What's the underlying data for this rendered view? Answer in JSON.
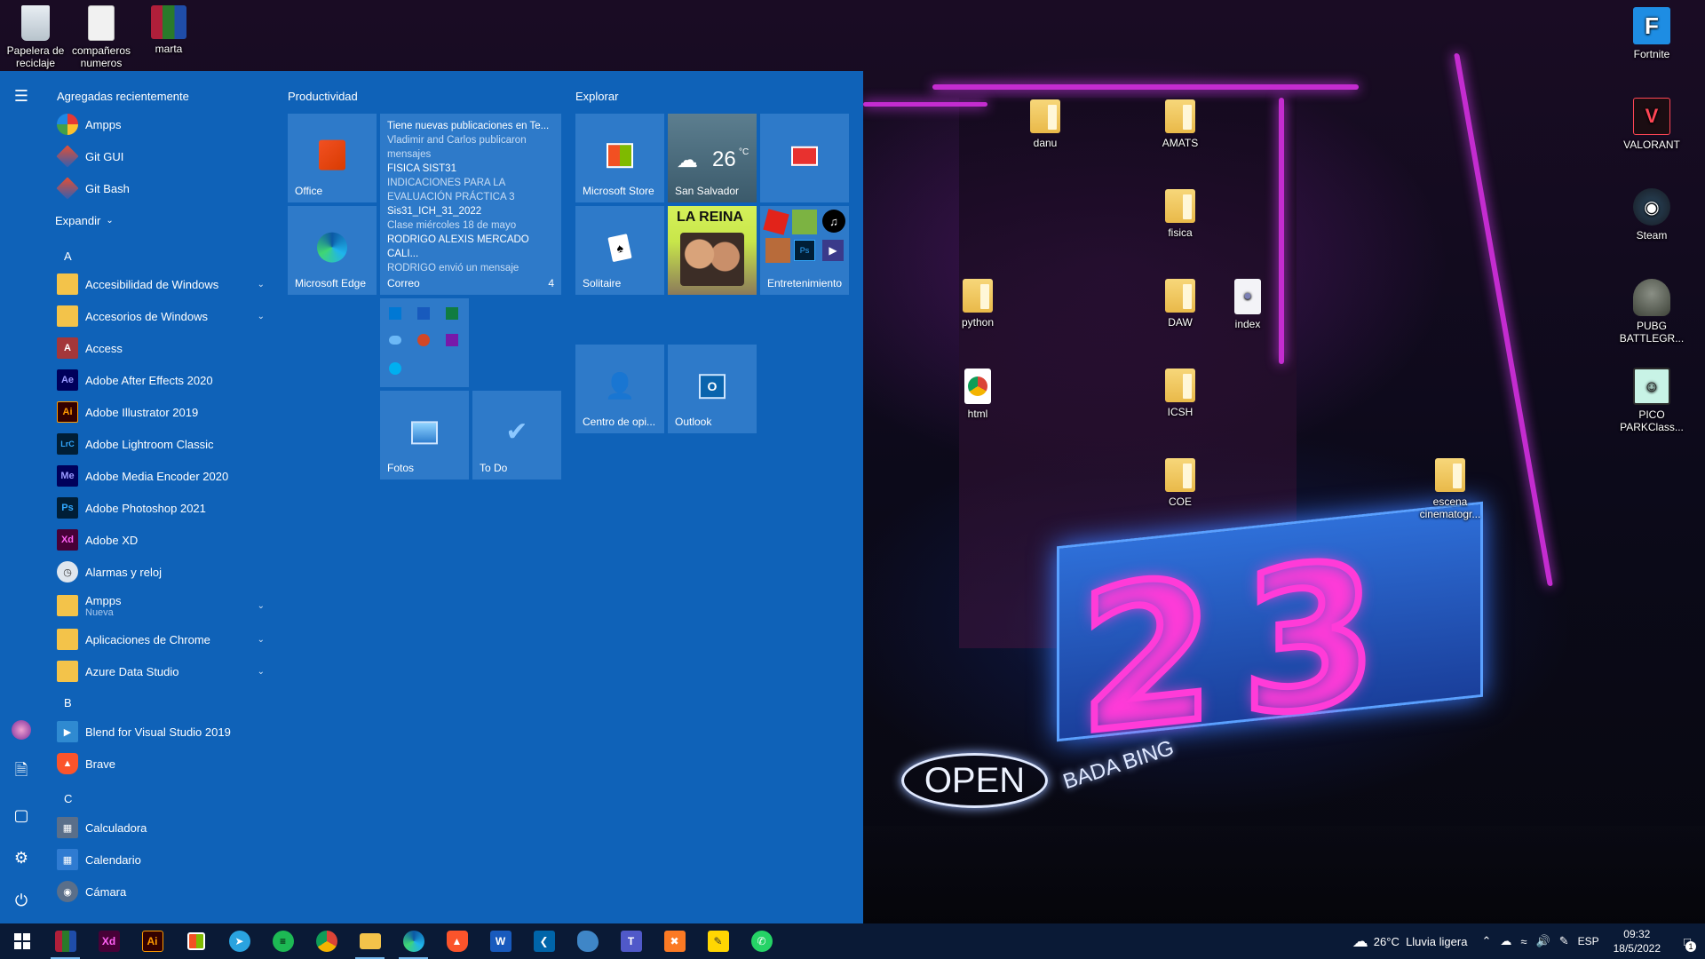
{
  "desktop": {
    "top_icons": [
      {
        "label": "Papelera de reciclaje"
      },
      {
        "label": "compañeros numeros"
      },
      {
        "label": "marta"
      }
    ],
    "folders": [
      {
        "label": "danu"
      },
      {
        "label": "AMATS"
      },
      {
        "label": "fisica"
      },
      {
        "label": "python"
      },
      {
        "label": "DAW"
      },
      {
        "label": "index"
      },
      {
        "label": "html"
      },
      {
        "label": "ICSH"
      },
      {
        "label": "COE"
      },
      {
        "label": "escena cinematogr..."
      }
    ],
    "right_icons": [
      {
        "label": "Fortnite"
      },
      {
        "label": "VALORANT"
      },
      {
        "label": "Steam"
      },
      {
        "label": "PUBG BATTLEGR..."
      },
      {
        "label": "PICO PARKClass..."
      }
    ],
    "wallpaper": {
      "sign_number": "23",
      "neon_open": "OPEN",
      "neon_bada": "BADA BING"
    }
  },
  "start_menu": {
    "recent_header": "Agregadas recientemente",
    "recent": [
      {
        "label": "Ampps"
      },
      {
        "label": "Git GUI"
      },
      {
        "label": "Git Bash"
      }
    ],
    "expand_label": "Expandir",
    "letters": {
      "a": "A",
      "b": "B",
      "c": "C"
    },
    "apps_a": [
      {
        "label": "Accesibilidad de Windows",
        "icon": "A"
      },
      {
        "label": "Accesorios de Windows",
        "icon": ""
      },
      {
        "label": "Access",
        "icon": "A"
      },
      {
        "label": "Adobe After Effects 2020",
        "icon": "Ae"
      },
      {
        "label": "Adobe Illustrator 2019",
        "icon": "Ai"
      },
      {
        "label": "Adobe Lightroom Classic",
        "icon": "LrC"
      },
      {
        "label": "Adobe Media Encoder 2020",
        "icon": "Me"
      },
      {
        "label": "Adobe Photoshop 2021",
        "icon": "Ps"
      },
      {
        "label": "Adobe XD",
        "icon": "Xd"
      },
      {
        "label": "Alarmas y reloj",
        "icon": ""
      },
      {
        "label": "Ampps",
        "sub": "Nueva",
        "icon": ""
      },
      {
        "label": "Aplicaciones de Chrome",
        "icon": ""
      },
      {
        "label": "Azure Data Studio",
        "icon": ""
      }
    ],
    "apps_b": [
      {
        "label": "Blend for Visual Studio 2019"
      },
      {
        "label": "Brave"
      }
    ],
    "apps_c": [
      {
        "label": "Calculadora"
      },
      {
        "label": "Calendario"
      },
      {
        "label": "Cámara"
      }
    ],
    "groups": {
      "productividad": "Productividad",
      "explorar": "Explorar"
    },
    "tiles": {
      "office": "Office",
      "edge": "Microsoft Edge",
      "mail": {
        "lines": [
          "Tiene nuevas publicaciones en Te...",
          "Vladimir and Carlos publicaron mensajes",
          "FISICA SIST31",
          "INDICACIONES PARA LA EVALUACIÓN PRÁCTICA 3",
          "Sis31_ICH_31_2022",
          "Clase miércoles 18 de mayo",
          "RODRIGO ALEXIS MERCADO CALI...",
          "RODRIGO envió un mensaje"
        ],
        "label": "Correo",
        "count": "4"
      },
      "fotos": "Fotos",
      "todo": "To Do",
      "store": "Microsoft Store",
      "weather_temp": "26",
      "weather_unit": "°C",
      "weather_city": "San Salvador",
      "solitaire": "Solitaire",
      "music_title": "LA REINA",
      "entretenimiento": "Entretenimiento",
      "centro": "Centro de opi...",
      "outlook": "Outlook"
    }
  },
  "taskbar": {
    "weather": "26°C  Lluvia ligera",
    "lang": "ESP",
    "time": "09:32",
    "date": "18/5/2022",
    "notif_count": "1"
  },
  "colors": {
    "start_bg": "#0f62b8",
    "tile_bg": "#2e7ac9",
    "taskbar_bg": "#0a1a36",
    "neon_pink": "#ff3bd8"
  }
}
